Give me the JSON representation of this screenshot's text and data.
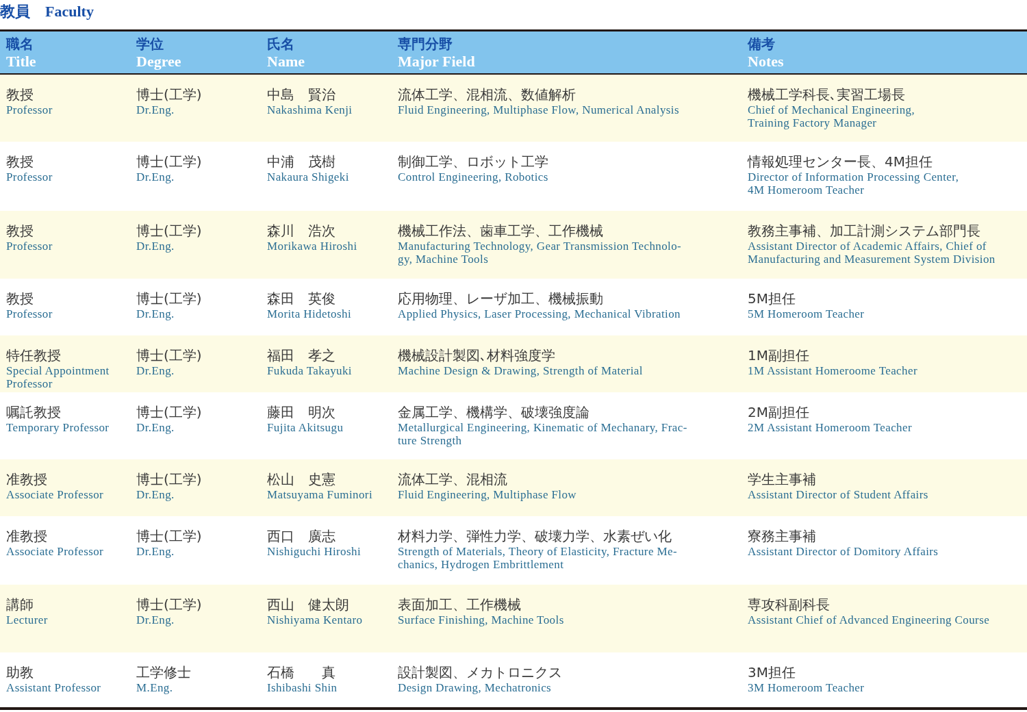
{
  "heading": {
    "ja": "教員",
    "en": "Faculty"
  },
  "table": {
    "columns": [
      {
        "ja": "職名",
        "en": "Title"
      },
      {
        "ja": "学位",
        "en": "Degree"
      },
      {
        "ja": "氏名",
        "en": "Name"
      },
      {
        "ja": "専門分野",
        "en": "Major Field"
      },
      {
        "ja": "備考",
        "en": "Notes"
      }
    ],
    "rows": [
      {
        "cells": [
          {
            "ja": "教授",
            "en": [
              "Professor"
            ]
          },
          {
            "ja": "博士(工学)",
            "en": [
              "Dr.Eng."
            ]
          },
          {
            "ja": "中島　賢治",
            "en": [
              "Nakashima Kenji"
            ]
          },
          {
            "ja": "流体工学、混相流、数値解析",
            "en": [
              "Fluid Engineering, Multiphase Flow, Numerical Analysis"
            ]
          },
          {
            "ja": "機械工学科長､実習工場長",
            "en": [
              "Chief of Mechanical Engineering,",
              "Training Factory Manager"
            ]
          }
        ]
      },
      {
        "cells": [
          {
            "ja": "教授",
            "en": [
              "Professor"
            ]
          },
          {
            "ja": "博士(工学)",
            "en": [
              "Dr.Eng."
            ]
          },
          {
            "ja": "中浦　茂樹",
            "en": [
              "Nakaura Shigeki"
            ]
          },
          {
            "ja": "制御工学、ロボット工学",
            "en": [
              "Control Engineering, Robotics"
            ]
          },
          {
            "ja": "情報処理センター長、4M担任",
            "en": [
              "Director of Information Processing Center,",
              "4M Homeroom Teacher"
            ]
          }
        ]
      },
      {
        "cells": [
          {
            "ja": "教授",
            "en": [
              "Professor"
            ]
          },
          {
            "ja": "博士(工学)",
            "en": [
              "Dr.Eng."
            ]
          },
          {
            "ja": "森川　浩次",
            "en": [
              "Morikawa Hiroshi"
            ]
          },
          {
            "ja": "機械工作法、歯車工学、工作機械",
            "en": [
              "Manufacturing Technology, Gear Transmission Technolo-",
              "gy, Machine Tools"
            ]
          },
          {
            "ja": "教務主事補、加工計測システム部門長",
            "en": [
              "Assistant Director of Academic Affairs, Chief of",
              "Manufacturing and Measurement System Division"
            ]
          }
        ]
      },
      {
        "cells": [
          {
            "ja": "教授",
            "en": [
              "Professor"
            ]
          },
          {
            "ja": "博士(工学)",
            "en": [
              "Dr.Eng."
            ]
          },
          {
            "ja": "森田　英俊",
            "en": [
              "Morita Hidetoshi"
            ]
          },
          {
            "ja": "応用物理、レーザ加工、機械振動",
            "en": [
              "Applied Physics, Laser Processing, Mechanical Vibration"
            ]
          },
          {
            "ja": "5M担任",
            "en": [
              "5M Homeroom Teacher"
            ]
          }
        ]
      },
      {
        "cells": [
          {
            "ja": "特任教授",
            "en": [
              "Special Appointment",
              "Professor"
            ]
          },
          {
            "ja": "博士(工学)",
            "en": [
              "Dr.Eng."
            ]
          },
          {
            "ja": "福田　孝之",
            "en": [
              "Fukuda Takayuki"
            ]
          },
          {
            "ja": "機械設計製図､材料強度学",
            "en": [
              "Machine Design & Drawing,  Strength of Material"
            ]
          },
          {
            "ja": "1M副担任",
            "en": [
              "1M Assistant Homeroome Teacher"
            ]
          }
        ]
      },
      {
        "cells": [
          {
            "ja": "嘱託教授",
            "en": [
              "Temporary Professor"
            ]
          },
          {
            "ja": "博士(工学)",
            "en": [
              "Dr.Eng."
            ]
          },
          {
            "ja": "藤田　明次",
            "en": [
              "Fujita Akitsugu"
            ]
          },
          {
            "ja": "金属工学、機構学、破壊強度論",
            "en": [
              "Metallurgical Engineering, Kinematic of Mechanary, Frac-",
              "ture Strength"
            ]
          },
          {
            "ja": "2M副担任",
            "en": [
              "2M Assistant Homeroom Teacher"
            ]
          }
        ]
      },
      {
        "cells": [
          {
            "ja": "准教授",
            "en": [
              "Associate Professor"
            ]
          },
          {
            "ja": "博士(工学)",
            "en": [
              "Dr.Eng."
            ]
          },
          {
            "ja": "松山　史憲",
            "en": [
              "Matsuyama Fuminori"
            ]
          },
          {
            "ja": "流体工学、混相流",
            "en": [
              "Fluid Engineering, Multiphase Flow"
            ]
          },
          {
            "ja": "学生主事補",
            "en": [
              "Assistant Director of Student Affairs"
            ]
          }
        ]
      },
      {
        "cells": [
          {
            "ja": "准教授",
            "en": [
              "Associate Professor"
            ]
          },
          {
            "ja": "博士(工学)",
            "en": [
              "Dr.Eng."
            ]
          },
          {
            "ja": "西口　廣志",
            "en": [
              "Nishiguchi Hiroshi"
            ]
          },
          {
            "ja": "材料力学、弾性力学、破壊力学、水素ぜい化",
            "en": [
              "Strength of Materials, Theory of Elasticity, Fracture Me-",
              "chanics, Hydrogen Embrittlement"
            ]
          },
          {
            "ja": "寮務主事補",
            "en": [
              "Assistant Director of Domitory Affairs"
            ]
          }
        ]
      },
      {
        "cells": [
          {
            "ja": "講師",
            "en": [
              "Lecturer"
            ]
          },
          {
            "ja": "博士(工学)",
            "en": [
              "Dr.Eng."
            ]
          },
          {
            "ja": "西山　健太朗",
            "en": [
              "Nishiyama Kentaro"
            ]
          },
          {
            "ja": "表面加工、工作機械",
            "en": [
              "Surface Finishing, Machine Tools"
            ]
          },
          {
            "ja": "専攻科副科長",
            "en": [
              "Assistant Chief of Advanced Engineering Course"
            ]
          }
        ]
      },
      {
        "cells": [
          {
            "ja": "助教",
            "en": [
              "Assistant Professor"
            ]
          },
          {
            "ja": "工学修士",
            "en": [
              "M.Eng."
            ]
          },
          {
            "ja": "石橋　　真",
            "en": [
              "Ishibashi Shin"
            ]
          },
          {
            "ja": "設計製図、メカトロニクス",
            "en": [
              "Design Drawing, Mechatronics"
            ]
          },
          {
            "ja": "3M担任",
            "en": [
              "3M Homeroom Teacher"
            ]
          }
        ]
      }
    ]
  }
}
